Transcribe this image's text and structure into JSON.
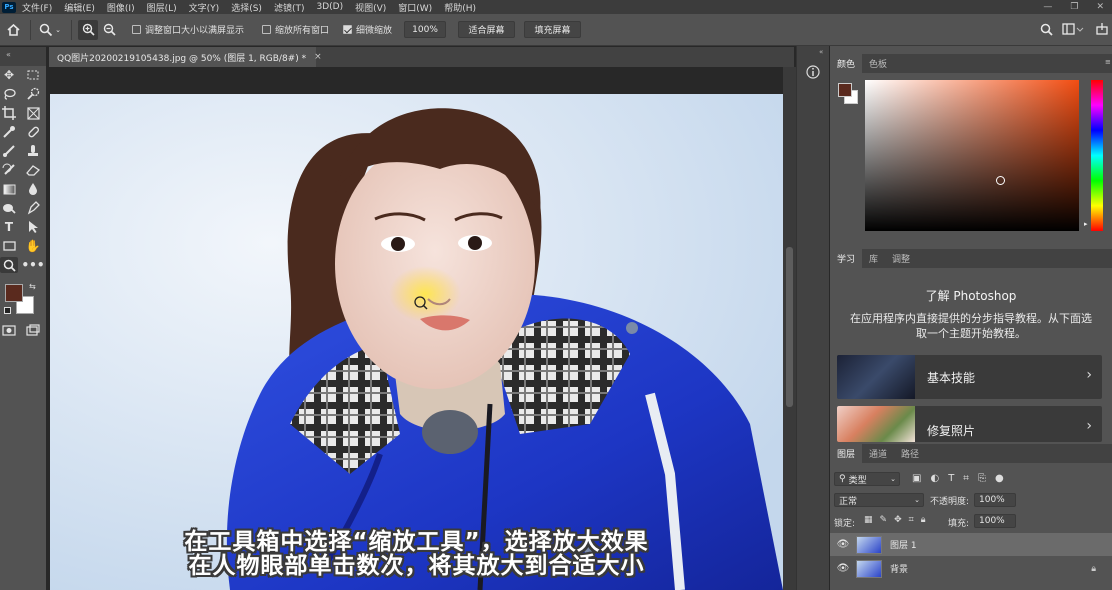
{
  "app": {
    "logo": "Ps"
  },
  "menu": [
    "文件(F)",
    "编辑(E)",
    "图像(I)",
    "图层(L)",
    "文字(Y)",
    "选择(S)",
    "滤镜(T)",
    "3D(D)",
    "视图(V)",
    "窗口(W)",
    "帮助(H)"
  ],
  "options": {
    "resize_windows_label": "调整窗口大小以满屏显示",
    "zoom_all_label": "缩放所有窗口",
    "scrubby_zoom_label": "细微缩放",
    "zoom_value": "100%",
    "fit_screen_label": "适合屏幕",
    "fill_screen_label": "填充屏幕",
    "resize_windows_checked": false,
    "zoom_all_checked": false,
    "scrubby_zoom_checked": true
  },
  "document": {
    "tab_title": "QQ图片20200219105438.jpg @ 50% (图层 1, RGB/8#) *",
    "close": "×"
  },
  "colors": {
    "foreground": "#5a2a1e",
    "background": "#ffffff"
  },
  "color_panel": {
    "tabs": [
      "颜色",
      "色板"
    ],
    "active": "颜色"
  },
  "learn_panel": {
    "tabs": [
      "学习",
      "库",
      "调整"
    ],
    "title": "了解 Photoshop",
    "description": "在应用程序内直接提供的分步指导教程。从下面选取一个主题开始教程。",
    "cards": [
      {
        "label": "基本技能"
      },
      {
        "label": "修复照片"
      }
    ]
  },
  "layers_panel": {
    "tabs": [
      "图层",
      "通道",
      "路径"
    ],
    "filter_kind": "类型",
    "blend_mode": "正常",
    "opacity_label": "不透明度:",
    "opacity_value": "100%",
    "lock_label": "锁定:",
    "fill_label": "填充:",
    "fill_value": "100%",
    "layers": [
      {
        "name": "图层 1",
        "selected": true,
        "locked": false
      },
      {
        "name": "背景",
        "selected": false,
        "locked": true
      }
    ]
  },
  "subtitles": {
    "line1": "在工具箱中选择“缩放工具”，选择放大效果",
    "line2": "在人物眼部单击数次，将其放大到合适大小"
  }
}
